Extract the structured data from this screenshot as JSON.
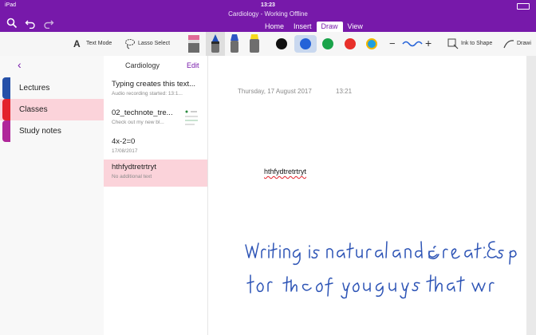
{
  "status": {
    "device": "iPad",
    "time": "13:23",
    "window_title": "Cardiology - Working Offline"
  },
  "tabs": [
    {
      "label": "Home"
    },
    {
      "label": "Insert"
    },
    {
      "label": "Draw"
    },
    {
      "label": "View"
    }
  ],
  "toolbar": {
    "text_mode": "Text Mode",
    "lasso_select": "Lasso Select",
    "ink_to_shape": "Ink to Shape",
    "drawing": "Drawi",
    "minus": "−",
    "plus": "+",
    "colors": [
      "#111111",
      "#2462d8",
      "#1aa34a",
      "#e8302a",
      "#1e9fe0"
    ]
  },
  "navigation": {
    "back_glyph": "‹",
    "notebook": "Cardiology",
    "edit": "Edit"
  },
  "sections": [
    {
      "label": "Lectures",
      "color": "#2650a8"
    },
    {
      "label": "Classes",
      "color": "#e3222b"
    },
    {
      "label": "Study notes",
      "color": "#b0279a"
    }
  ],
  "pages": [
    {
      "title": "Typing creates this text...",
      "subtitle": "Audio recording started: 13:1..."
    },
    {
      "title": "02_technote_tre...",
      "subtitle": "Check out my new bl..."
    },
    {
      "title": "4x-2=0",
      "subtitle": "17/08/2017"
    },
    {
      "title": "hthfydtretrtryt",
      "subtitle": "No additional text"
    }
  ],
  "note": {
    "date": "Thursday, 17 August 2017",
    "time": "13:21",
    "text": "hthfydtretrtryt"
  }
}
